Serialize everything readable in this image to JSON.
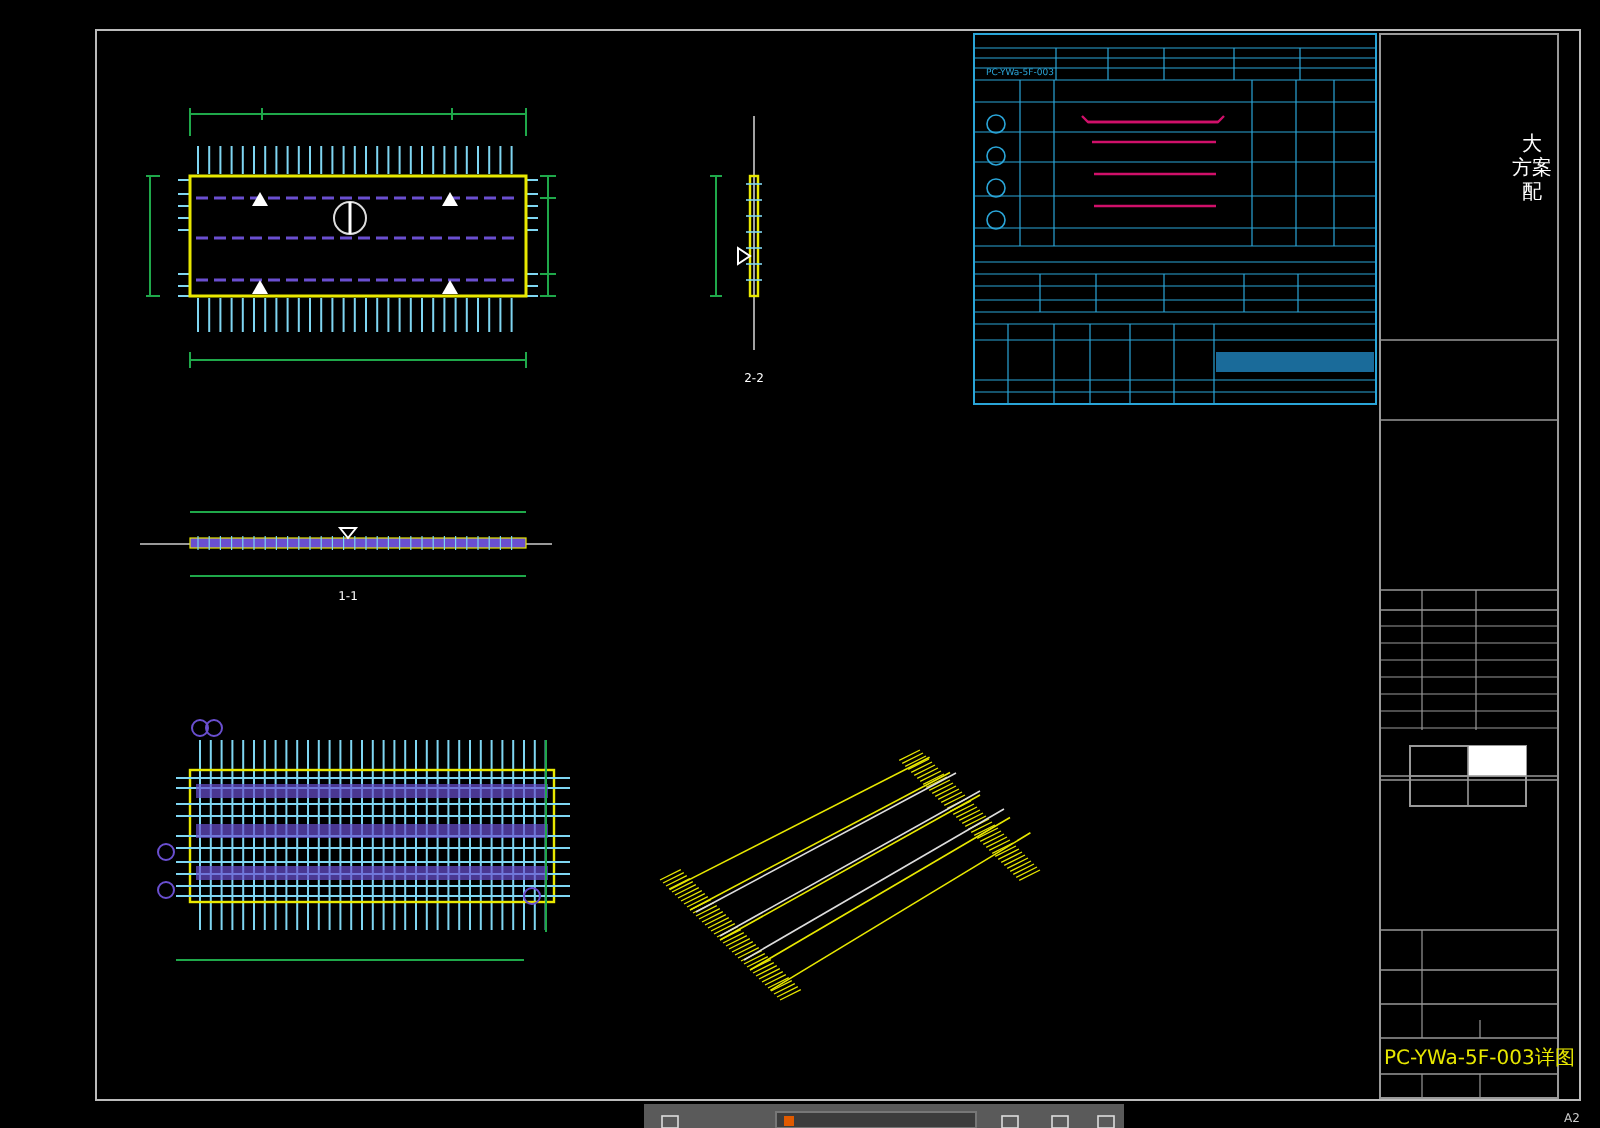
{
  "schedule_table": {
    "first_row_label": "PC-YWa-5F-003"
  },
  "views": [
    {
      "kind": "section",
      "label": "2-2"
    },
    {
      "kind": "elevation",
      "label": "1-1"
    }
  ],
  "title_block": {
    "vertical_text": [
      "大",
      "方案",
      "配"
    ],
    "drawing_number": "PC-YWa-5F-003详图"
  },
  "sheet_size": "A2"
}
